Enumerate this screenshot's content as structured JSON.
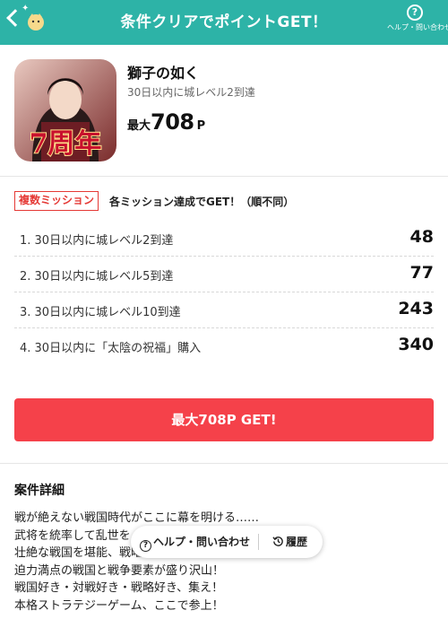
{
  "header": {
    "title": "条件クリアでポイントGET！",
    "help_label": "ヘルプ・問い合わせ",
    "help_symbol": "?"
  },
  "app": {
    "name": "獅子の如く",
    "subtitle": "30日以内に城レベル2到達",
    "max_label": "最大",
    "max_value": "708",
    "max_unit": "P",
    "icon_banner": "7周年"
  },
  "mission": {
    "badge": "複数ミッション",
    "note": "各ミッション達成でGET！（順不同）",
    "items": [
      {
        "label": "1. 30日以内に城レベル2到達",
        "points": "48"
      },
      {
        "label": "2. 30日以内に城レベル5到達",
        "points": "77"
      },
      {
        "label": "3. 30日以内に城レベル10到達",
        "points": "243"
      },
      {
        "label": "4. 30日以内に「太陰の祝福」購入",
        "points": "340"
      }
    ]
  },
  "cta": {
    "label": "最大708P GET!"
  },
  "details": {
    "title": "案件詳細",
    "lines": [
      "戦が絶えない戦国時代がここに幕を明ける……",
      "武将を統率して乱世を",
      "壮絶な戦国を堪能、戦略性にも…",
      "迫力満点の戦国と戦争要素が盛り沢山！",
      "戦国好き・対戦好き・戦略好き、集え！",
      "本格ストラテジーゲーム、ここで参上！"
    ]
  },
  "floating_bar": {
    "help_label": "ヘルプ・問い合わせ",
    "history_label": "履歴"
  },
  "colors": {
    "header_bg": "#2db3a7",
    "cta_bg": "#f5414a",
    "badge": "#e53935"
  }
}
